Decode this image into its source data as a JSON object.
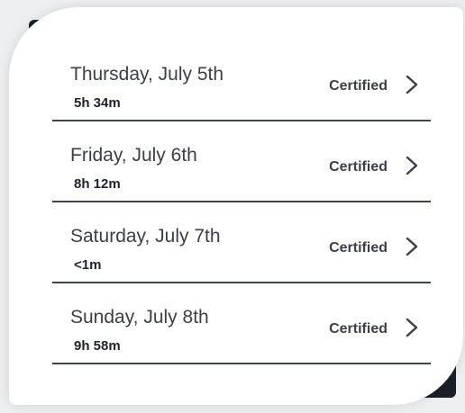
{
  "days": [
    {
      "date": "Thursday, July 5th",
      "duration": "5h 34m",
      "status": "Certified"
    },
    {
      "date": "Friday, July 6th",
      "duration": "8h 12m",
      "status": "Certified"
    },
    {
      "date": "Saturday, July 7th",
      "duration": "<1m",
      "status": "Certified"
    },
    {
      "date": "Sunday, July 8th",
      "duration": "9h 58m",
      "status": "Certified"
    }
  ],
  "icons": {
    "row_action": "chevron-right-icon"
  },
  "colors": {
    "divider": "#3e4350",
    "text": "#3b3f4a"
  }
}
